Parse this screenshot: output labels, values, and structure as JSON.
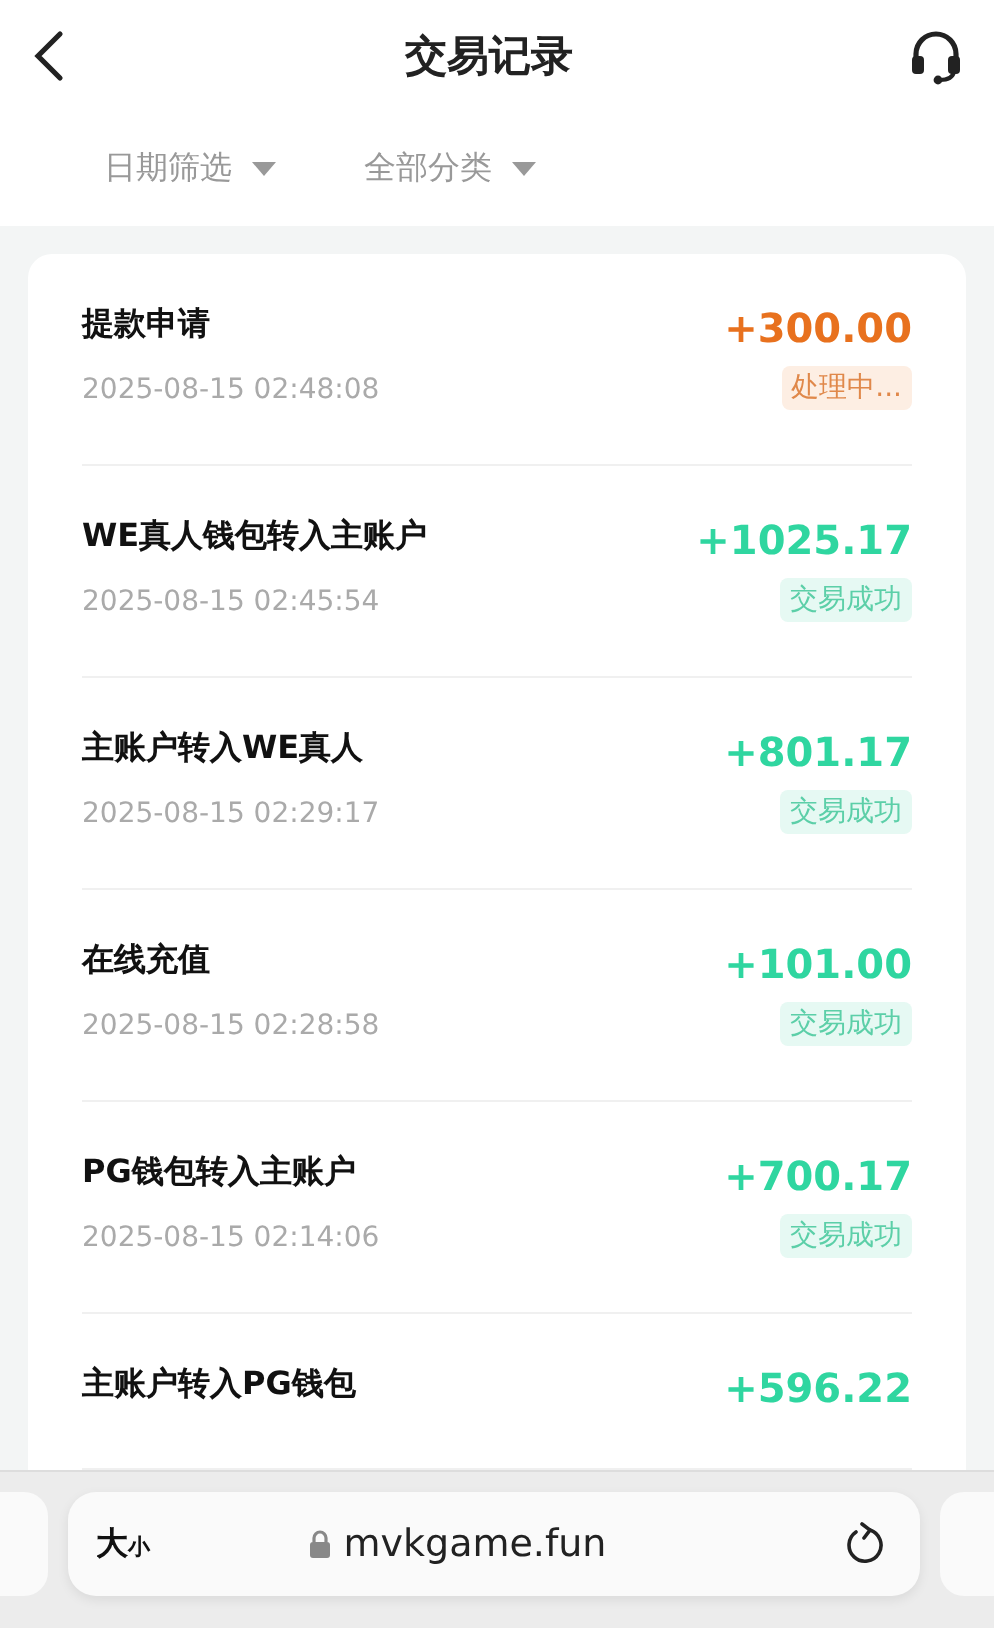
{
  "header": {
    "title": "交易记录"
  },
  "filters": [
    {
      "label": "日期筛选"
    },
    {
      "label": "全部分类"
    }
  ],
  "transactions": [
    {
      "title": "提款申请",
      "time": "2025-08-15 02:48:08",
      "amount": "+300.00",
      "status": "处理中...",
      "kind": "pending"
    },
    {
      "title": "WE真人钱包转入主账户",
      "time": "2025-08-15 02:45:54",
      "amount": "+1025.17",
      "status": "交易成功",
      "kind": "success"
    },
    {
      "title": "主账户转入WE真人",
      "time": "2025-08-15 02:29:17",
      "amount": "+801.17",
      "status": "交易成功",
      "kind": "success"
    },
    {
      "title": "在线充值",
      "time": "2025-08-15 02:28:58",
      "amount": "+101.00",
      "status": "交易成功",
      "kind": "success"
    },
    {
      "title": "PG钱包转入主账户",
      "time": "2025-08-15 02:14:06",
      "amount": "+700.17",
      "status": "交易成功",
      "kind": "success"
    },
    {
      "title": "主账户转入PG钱包",
      "amount": "+596.22",
      "kind": "success"
    }
  ],
  "browser_bar": {
    "text_size_large": "大",
    "text_size_small": "小",
    "url": "mvkgame.fun"
  }
}
